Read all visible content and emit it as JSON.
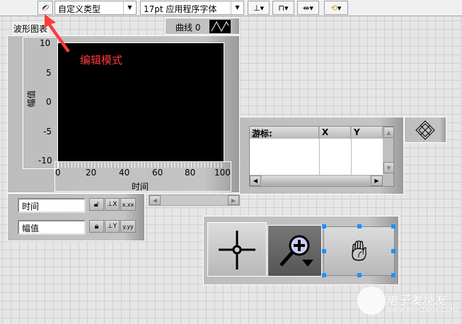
{
  "toolbar": {
    "edit_mode_icon": "pen-icon",
    "style_dropdown": "自定义类型",
    "font_dropdown": "17pt 应用程序字体",
    "align_icons": [
      "align-objects-icon",
      "distribute-objects-icon",
      "resize-objects-icon",
      "reorder-icon"
    ]
  },
  "annotation": {
    "text": "编辑模式",
    "color": "#ff3333"
  },
  "chart": {
    "label": "波形图表",
    "legend_plot": "曲线 0",
    "y_label": "幅值",
    "x_label": "时间",
    "y_ticks": [
      "10",
      "5",
      "0",
      "-5",
      "-10"
    ],
    "x_ticks": [
      "0",
      "20",
      "40",
      "60",
      "80",
      "100"
    ]
  },
  "scale_legend": {
    "x_name": "时间",
    "y_name": "幅值",
    "x_format": "x.xx",
    "y_format": "y.yy"
  },
  "cursor_legend": {
    "headers": [
      "游标:",
      "X",
      "Y"
    ]
  },
  "palette": {
    "tools": [
      "cursor-tool",
      "zoom-tool",
      "pan-tool"
    ]
  },
  "watermark": {
    "cn": "电子发烧友",
    "url": "www.elecfans.com"
  }
}
